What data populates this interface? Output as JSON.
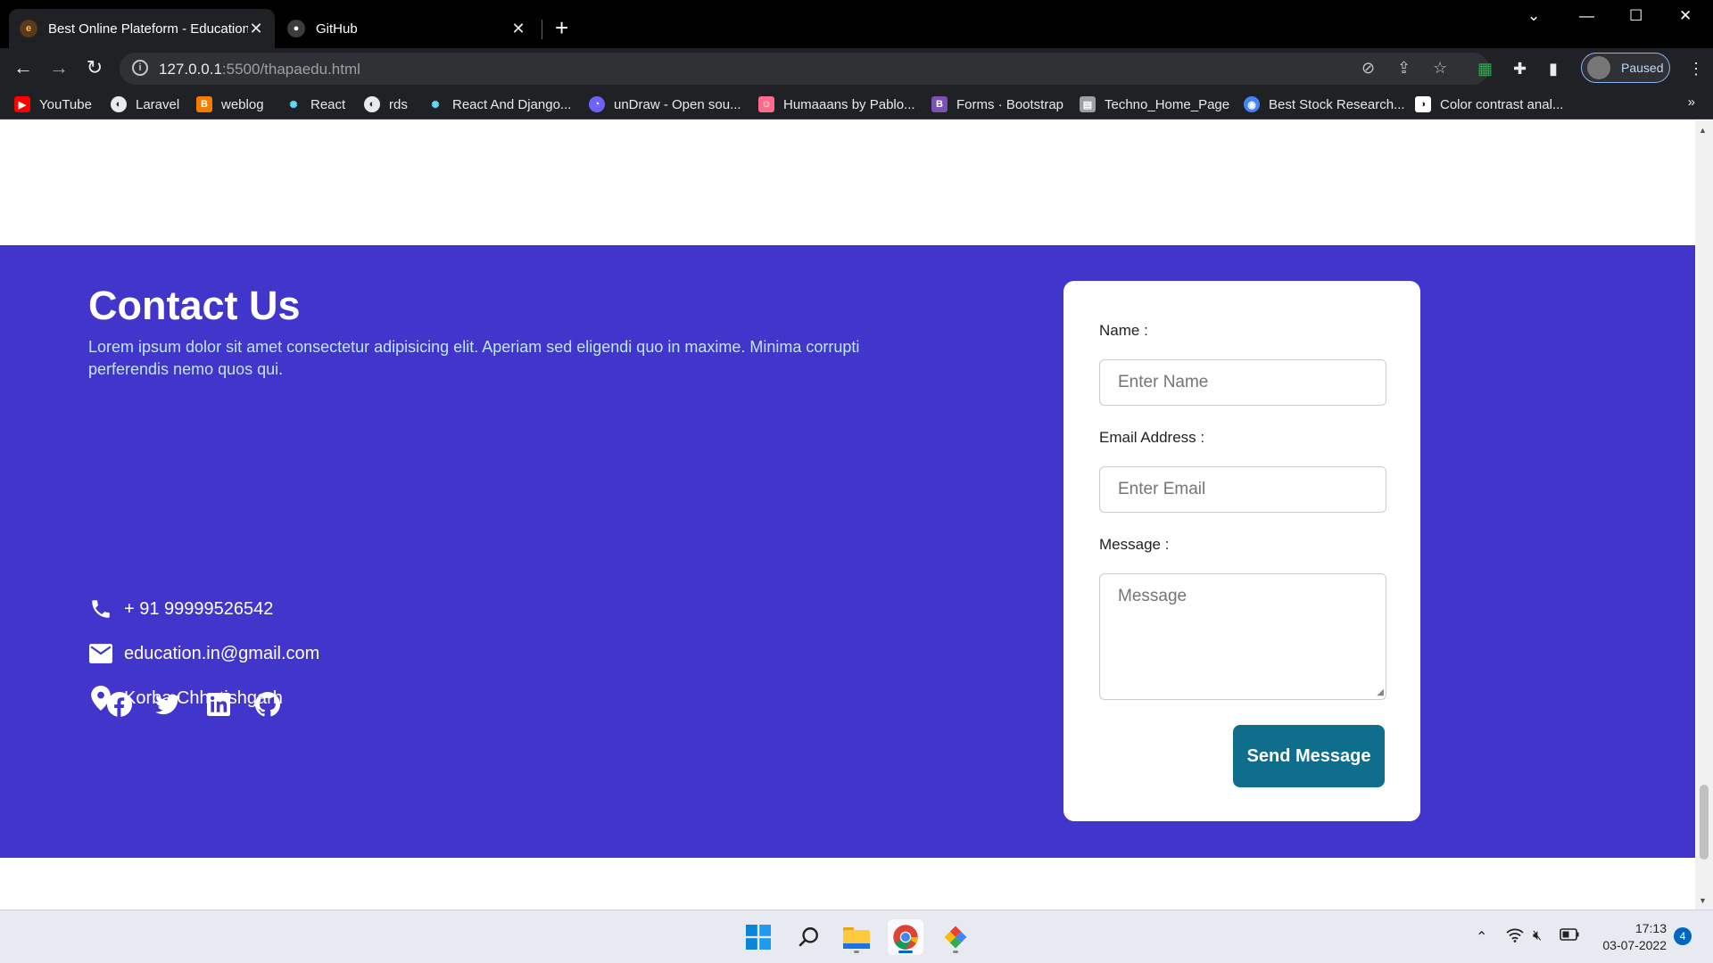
{
  "browser": {
    "tabs": [
      {
        "title": "Best Online Plateform - Education",
        "active": true
      },
      {
        "title": "GitHub",
        "active": false
      }
    ],
    "url_host": "127.0.0.1",
    "url_path": ":5500/thapaedu.html",
    "profile_status": "Paused",
    "bookmarks": [
      {
        "label": "YouTube",
        "icon": "youtube-icon",
        "color": "#ff0000"
      },
      {
        "label": "Laravel",
        "icon": "globe-icon",
        "color": "#e8eaed"
      },
      {
        "label": "weblog",
        "icon": "weblog-icon",
        "color": "#f57c00"
      },
      {
        "label": "React",
        "icon": "react-icon",
        "color": "#61dafb"
      },
      {
        "label": "rds",
        "icon": "globe-icon",
        "color": "#e8eaed"
      },
      {
        "label": "React And Django...",
        "icon": "react-icon",
        "color": "#61dafb"
      },
      {
        "label": "unDraw - Open sou...",
        "icon": "undraw-icon",
        "color": "#6c63ff"
      },
      {
        "label": "Humaaans by Pablo...",
        "icon": "humaaans-icon",
        "color": "#ff6b8a"
      },
      {
        "label": "Forms · Bootstrap",
        "icon": "bootstrap-icon",
        "color": "#7952b3"
      },
      {
        "label": "Techno_Home_Page",
        "icon": "page-icon",
        "color": "#9aa0a6"
      },
      {
        "label": "Best Stock Research...",
        "icon": "stock-icon",
        "color": "#4285f4"
      },
      {
        "label": "Color contrast anal...",
        "icon": "contrast-icon",
        "color": "#ffffff"
      }
    ]
  },
  "contact": {
    "title": "Contact Us",
    "description": "Lorem ipsum dolor sit amet consectetur adipisicing elit. Aperiam sed eligendi quo in maxime. Minima corrupti perferendis nemo quos qui.",
    "phone": "+ 91 99999526542",
    "email": "education.in@gmail.com",
    "location": "Korba Chhatishgarh",
    "background_color": "#4135cc"
  },
  "form": {
    "name_label": "Name :",
    "name_placeholder": "Enter Name",
    "email_label": "Email Address :",
    "email_placeholder": "Enter Email",
    "message_label": "Message :",
    "message_placeholder": "Message",
    "submit_label": "Send Message",
    "submit_color": "#0f6e8c"
  },
  "taskbar": {
    "time": "17:13",
    "date": "03-07-2022",
    "notification_count": "4"
  }
}
